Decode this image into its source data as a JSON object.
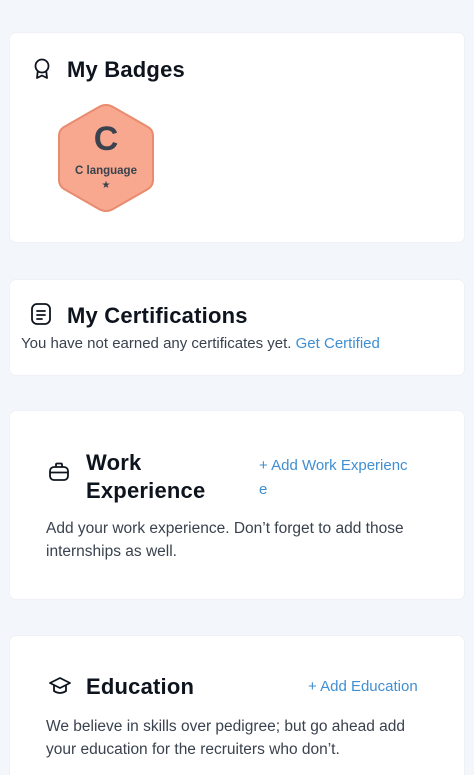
{
  "badges": {
    "title": "My Badges",
    "items": [
      {
        "letter": "C",
        "name": "C language",
        "star": "★"
      }
    ]
  },
  "certifications": {
    "title": "My Certifications",
    "message": "You have not earned any certificates yet.",
    "link": "Get Certified"
  },
  "work": {
    "title_line1": "Work",
    "title_line2": "Experience",
    "add_line1": "+ Add Work Experienc",
    "add_line2": "e",
    "desc_line1": "Add your work experience. Don’t forget to add those",
    "desc_line2": "internships as well."
  },
  "education": {
    "title": "Education",
    "add": "+ Add Education",
    "desc_line1": "We believe in skills over pedigree; but go ahead add",
    "desc_line2": "your education for the recruiters who don’t."
  },
  "colors": {
    "page_bg": "#f3f6fa",
    "link": "#3f8fd2",
    "badge_fill": "#f7a88f",
    "badge_border": "#e98b6f"
  }
}
